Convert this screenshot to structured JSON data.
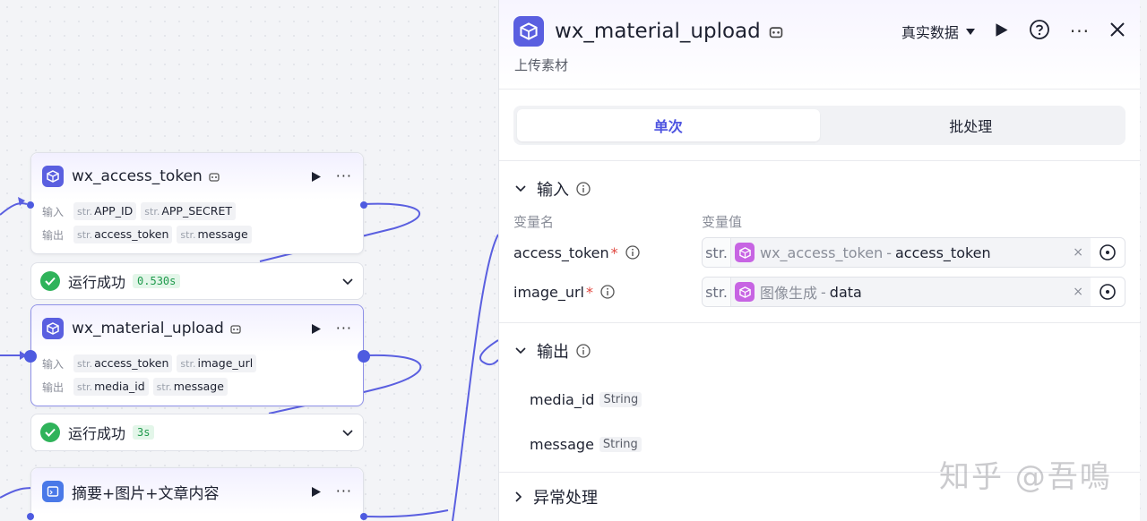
{
  "nodes": [
    {
      "title": "wx_access_token",
      "input_label": "输入",
      "output_label": "输出",
      "inputs": [
        {
          "type": "str.",
          "name": "APP_ID"
        },
        {
          "type": "str.",
          "name": "APP_SECRET"
        }
      ],
      "outputs": [
        {
          "type": "str.",
          "name": "access_token"
        },
        {
          "type": "str.",
          "name": "message"
        }
      ],
      "status": {
        "text": "运行成功",
        "time": "0.530s"
      }
    },
    {
      "title": "wx_material_upload",
      "input_label": "输入",
      "output_label": "输出",
      "inputs": [
        {
          "type": "str.",
          "name": "access_token"
        },
        {
          "type": "str.",
          "name": "image_url"
        }
      ],
      "outputs": [
        {
          "type": "str.",
          "name": "media_id"
        },
        {
          "type": "str.",
          "name": "message"
        }
      ],
      "status": {
        "text": "运行成功",
        "time": "3s"
      }
    },
    {
      "title": "摘要+图片+文章内容"
    }
  ],
  "panel": {
    "title": "wx_material_upload",
    "description": "上传素材",
    "data_mode": "真实数据",
    "tabs": [
      "单次",
      "批处理"
    ],
    "input_section": "输入",
    "col_name": "变量名",
    "col_value": "变量值",
    "variables": [
      {
        "name": "access_token",
        "required": "*",
        "type": "str.",
        "source": "wx_access_token",
        "sep": "-",
        "key": "access_token",
        "clear": "×"
      },
      {
        "name": "image_url",
        "required": "*",
        "type": "str.",
        "source": "图像生成",
        "sep": "-",
        "key": "data",
        "clear": "×"
      }
    ],
    "output_section": "输出",
    "outputs": [
      {
        "name": "media_id",
        "type": "String"
      },
      {
        "name": "message",
        "type": "String"
      }
    ],
    "next_section": "异常处理"
  },
  "watermark": "知乎 @吾鳴",
  "colors": {
    "accent": "#4d53e0",
    "success": "#2fb35a",
    "wire": "#5a5fe0"
  }
}
